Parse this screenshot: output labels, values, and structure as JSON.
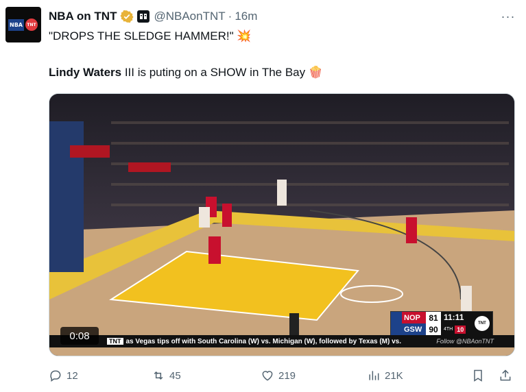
{
  "tweet": {
    "author_name": "NBA on TNT",
    "handle": "@NBAonTNT",
    "separator": "·",
    "time": "16m",
    "more": "···",
    "line1": "\"DROPS THE SLEDGE HAMMER!\" 💥",
    "line2_bold": "Lindy Waters",
    "line2_rest": " III is puting on a SHOW in The Bay 🍿"
  },
  "avatar": {
    "nba": "NBA",
    "tnt": "TNT"
  },
  "video": {
    "duration": "0:08",
    "scoreboard": {
      "team1": "NOP",
      "score1": "81",
      "team2": "GSW",
      "score2": "90",
      "clock": "11:11",
      "quarter": "4TH",
      "shot_clock": "10",
      "network": "TNT"
    },
    "ticker_label": "TNT",
    "ticker": "as Vegas tips off with South Carolina (W) vs. Michigan (W), followed by Texas (M) vs.",
    "follow": "Follow @NBAonTNT"
  },
  "metrics": {
    "replies": "12",
    "reposts": "45",
    "likes": "219",
    "views": "21K"
  },
  "colors": {
    "accent": "#1d9bf0",
    "muted": "#536471",
    "nop": "#c8102e",
    "gsw": "#1d428a"
  }
}
